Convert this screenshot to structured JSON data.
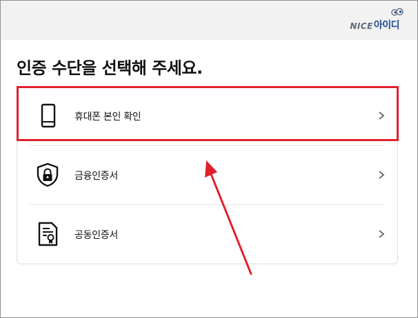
{
  "logo": {
    "nice": "NICE",
    "idi": "아이디"
  },
  "title": "인증 수단을 선택해 주세요.",
  "methods": [
    {
      "label": "휴대폰 본인 확인",
      "icon": "smartphone-icon"
    },
    {
      "label": "금융인증서",
      "icon": "shield-lock-icon"
    },
    {
      "label": "공동인증서",
      "icon": "certificate-document-icon"
    }
  ],
  "colors": {
    "highlight": "#e0202b",
    "arrow": "#e0202b",
    "header_bg": "#f2f2f2",
    "brand": "#1d4b8f"
  }
}
